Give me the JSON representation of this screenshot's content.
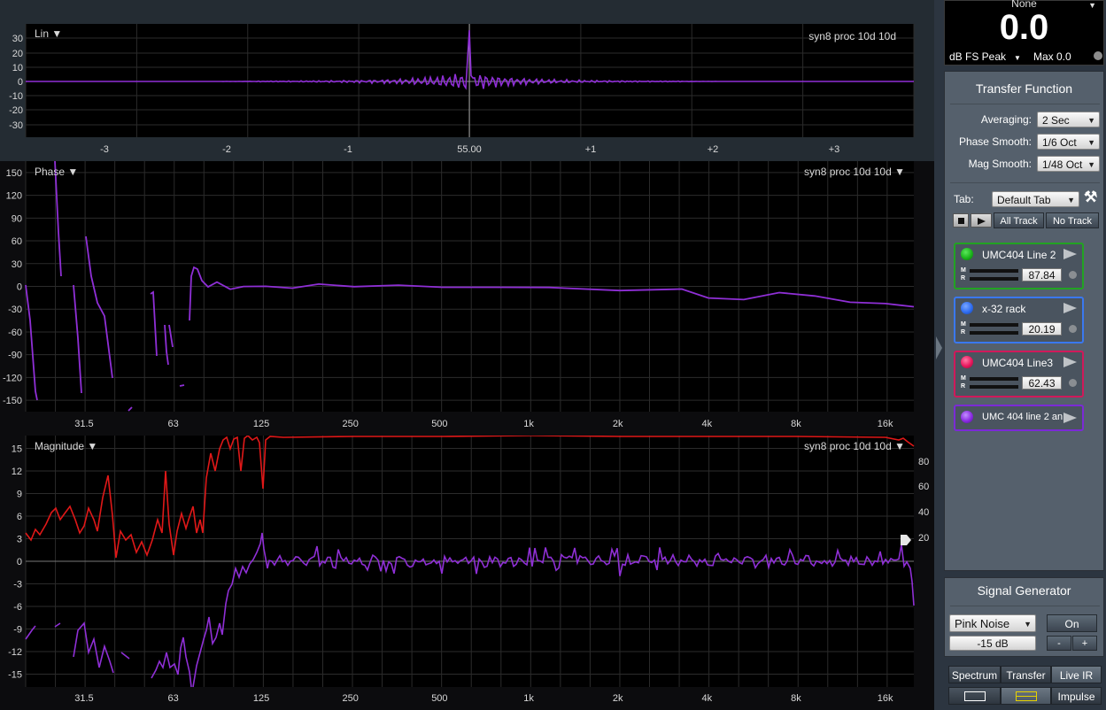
{
  "impulse_graph": {
    "scale_label": "Lin ▼",
    "trace_name": "syn8 proc 10d 10d",
    "y_ticks": [
      "30",
      "20",
      "10",
      "0",
      "-10",
      "-20",
      "-30"
    ],
    "x_ticks": [
      "-3",
      "-2",
      "-1",
      "55.00",
      "+1",
      "+2",
      "+3"
    ]
  },
  "phase_graph": {
    "label": "Phase ▼",
    "trace_name": "syn8 proc 10d 10d ▼",
    "y_ticks": [
      "150",
      "120",
      "90",
      "60",
      "30",
      "0",
      "-30",
      "-60",
      "-90",
      "-120",
      "-150"
    ],
    "x_ticks": [
      "31.5",
      "63",
      "125",
      "250",
      "500",
      "1k",
      "2k",
      "4k",
      "8k",
      "16k"
    ]
  },
  "magnitude_graph": {
    "label": "Magnitude ▼",
    "trace_name": "syn8 proc 10d 10d ▼",
    "y_ticks": [
      "15",
      "12",
      "9",
      "6",
      "3",
      "0",
      "-3",
      "-6",
      "-9",
      "-12",
      "-15"
    ],
    "y_ticks_right": [
      "80",
      "60",
      "40",
      "20"
    ],
    "x_ticks": [
      "31.5",
      "63",
      "125",
      "250",
      "500",
      "1k",
      "2k",
      "4k",
      "8k",
      "16k"
    ]
  },
  "meter": {
    "source": "None",
    "value": "0.0",
    "mode": "dB FS Peak",
    "max": "Max 0.0"
  },
  "transfer_function": {
    "title": "Transfer Function",
    "averaging_label": "Averaging:",
    "averaging_value": "2 Sec",
    "phase_smooth_label": "Phase Smooth:",
    "phase_smooth_value": "1/6 Oct",
    "mag_smooth_label": "Mag Smooth:",
    "mag_smooth_value": "1/48 Oct",
    "tab_label": "Tab:",
    "tab_value": "Default Tab",
    "all_track": "All Track",
    "no_track": "No Track"
  },
  "tracks": [
    {
      "name": "UMC404 Line 2",
      "value": "87.84",
      "color": "#1bb41b",
      "border": "#22a322"
    },
    {
      "name": "x-32 rack",
      "value": "20.19",
      "color": "#2f6df0",
      "border": "#3a78f0"
    },
    {
      "name": "UMC404 Line3",
      "value": "62.43",
      "color": "#e8175d",
      "border": "#d0195a"
    },
    {
      "name": "UMC 404 line 2 an...",
      "color": "#8a2be2",
      "border": "#7b2ad6"
    }
  ],
  "signal_generator": {
    "title": "Signal Generator",
    "type": "Pink Noise",
    "on_label": "On",
    "level": "-15 dB",
    "minus": "-",
    "plus": "+"
  },
  "view_tabs": {
    "spectrum": "Spectrum",
    "transfer": "Transfer",
    "live_ir": "Live IR",
    "impulse": "Impulse"
  },
  "colors": {
    "trace_purple": "#8f2fd6",
    "trace_red": "#e01818",
    "plot_bg": "#000000",
    "sidebar_bg": "#2c3540"
  }
}
